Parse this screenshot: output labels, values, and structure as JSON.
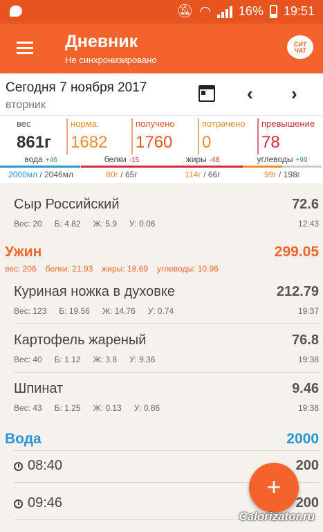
{
  "status_bar": {
    "battery": "16%",
    "time": "19:51",
    "colors": {
      "bg": "#e8541f"
    }
  },
  "app_bar": {
    "title": "Дневник",
    "subtitle": "Не синхронизировано",
    "chat_badge": "СИТ ЧАТ",
    "color": "#f2642c"
  },
  "date_bar": {
    "date": "Сегодня 7 ноября 2017",
    "weekday": "вторник",
    "prev": "‹",
    "next": "›"
  },
  "summary": {
    "weight": {
      "label": "вес",
      "value": "861г",
      "color": "#333333"
    },
    "norm": {
      "label": "норма",
      "value": "1682",
      "color": "#f08c2a"
    },
    "received": {
      "label": "получено",
      "value": "1760",
      "color": "#e8541f"
    },
    "spent": {
      "label": "потрачено",
      "value": "0",
      "color": "#f08c2a"
    },
    "excess": {
      "label": "превышение",
      "value": "78",
      "color": "#d42a3a"
    }
  },
  "macros": [
    {
      "name": "вода",
      "delta": "+46",
      "value": "2000мл",
      "total": " / 2046мл",
      "color": "#2a95d8",
      "delta_color": "#3a9c3a",
      "fill": 0.98
    },
    {
      "name": "белки",
      "delta": "-15",
      "value": "80г",
      "total": " / 65г",
      "color": "#d42a3a",
      "delta_color": "#d42a3a",
      "fill": 1.0
    },
    {
      "name": "жиры",
      "delta": "-48",
      "value": "114г",
      "total": " / 66г",
      "color": "#d42a3a",
      "delta_color": "#d42a3a",
      "fill": 1.0
    },
    {
      "name": "углеводы",
      "delta": "+99",
      "value": "99г",
      "total": " / 198г",
      "color": "#f08c2a",
      "delta_color": "#3a9c3a",
      "fill": 0.5
    }
  ],
  "prev_item": {
    "name": "Сыр Российский",
    "kcal": "72.6",
    "weight": "Вес: 20",
    "p": "Б: 4.82",
    "f": "Ж: 5.9",
    "c": "У: 0.06",
    "time": "12:43"
  },
  "dinner": {
    "title": "Ужин",
    "kcal": "299.05",
    "weight": "вес: 206",
    "protein": "белки: 21.93",
    "fat": "жиры: 18.69",
    "carbs": "углеводы: 10.96",
    "items": [
      {
        "name": "Куриная ножка в духовке",
        "kcal": "212.79",
        "weight": "Вес: 123",
        "p": "Б: 19.56",
        "f": "Ж: 14.76",
        "c": "У: 0.74",
        "time": "19:37"
      },
      {
        "name": "Картофель жареный",
        "kcal": "76.8",
        "weight": "Вес: 40",
        "p": "Б: 1.12",
        "f": "Ж: 3.8",
        "c": "У: 9.36",
        "time": "19:38"
      },
      {
        "name": "Шпинат",
        "kcal": "9.46",
        "weight": "Вес: 43",
        "p": "Б: 1.25",
        "f": "Ж: 0.13",
        "c": "У: 0.86",
        "time": "19:38"
      }
    ]
  },
  "water": {
    "title": "Вода",
    "total": "2000",
    "entries": [
      {
        "time": "08:40",
        "amount": "200"
      },
      {
        "time": "09:46",
        "amount": "200"
      }
    ]
  },
  "fab": {
    "label": "+"
  },
  "watermark": "Calorizator.ru"
}
